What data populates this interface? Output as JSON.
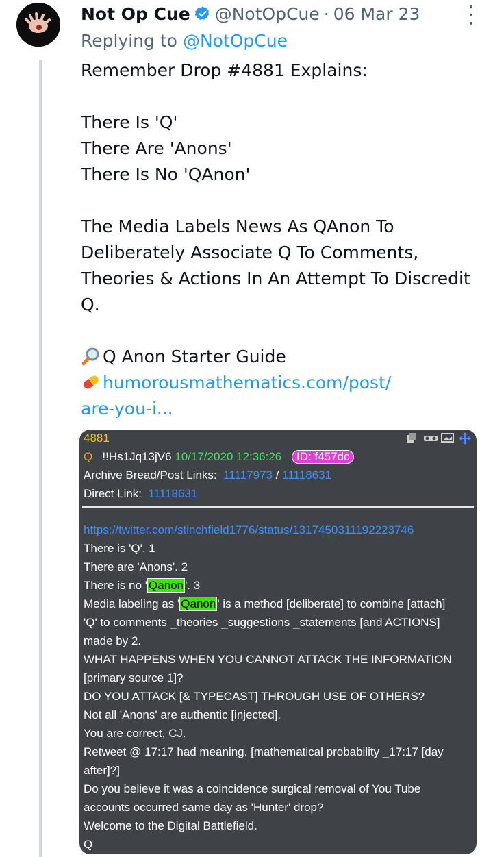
{
  "tweet": {
    "display_name": "Not Op Cue",
    "handle": "@NotOpCue",
    "separator": "·",
    "date": "06 Mar 23",
    "replying_to_label": "Replying to",
    "replying_to_handle": "@NotOpCue",
    "lines": [
      "Remember Drop #4881 Explains:",
      "",
      "There Is 'Q'",
      "There Are 'Anons'",
      "There Is No 'QAnon'",
      "",
      "The Media Labels News As QAnon To",
      "Deliberately Associate Q To Comments,",
      "Theories & Actions In An Attempt To Discredit",
      "Q.",
      ""
    ],
    "guide_label": "Q Anon Starter Guide",
    "link_line1": "humorousmathematics.com/post/",
    "link_line2": "are-you-i..."
  },
  "icons": {
    "verified": "verified-badge-icon",
    "more": "more-options-icon",
    "magnifier": "magnifying-glass-emoji",
    "pill": "pill-emoji"
  },
  "colors": {
    "link": "#1d9bf0",
    "muted": "#536471",
    "card_bg": "#3f4347",
    "highlight": "#39e600"
  },
  "drop": {
    "number": "4881",
    "q": "Q",
    "tripcode": "!!Hs1Jq13jV6",
    "timestamp": "10/17/2020 12:36:26",
    "id_badge": "ID: f457dc",
    "archive_label": "Archive Bread/Post Links:",
    "archive_link1": "11117973",
    "archive_sep": "/",
    "archive_link2": "11118631",
    "direct_label": "Direct Link:",
    "direct_link": "11118631",
    "url": "https://twitter.com/stinchfield1776/status/1317450311192223746",
    "l1": "There is 'Q'. 1",
    "l2": "There are 'Anons'. 2",
    "l3_pre": "There is no '",
    "l3_hl": "Qanon",
    "l3_post": "'. 3",
    "l4_pre": "Media labeling as '",
    "l4_hl": "Qanon",
    "l4_post": "' is a method [deliberate] to combine [attach]",
    "l5": "'Q' to comments _theories _suggestions _statements [and ACTIONS]",
    "l6": "made by 2.",
    "l7": "WHAT HAPPENS WHEN YOU CANNOT ATTACK THE INFORMATION",
    "l8": "[primary source 1]?",
    "l9": "DO YOU ATTACK [& TYPECAST] THROUGH USE OF OTHERS?",
    "l10": "Not all 'Anons' are authentic [injected].",
    "l11": "You are correct, CJ.",
    "l12": "Retweet @ 17:17 had meaning. [mathematical probability _17:17 [day",
    "l13": "after]?]",
    "l14": "Do you believe it was a coincidence surgical removal of You Tube",
    "l15": "accounts occurred same day as 'Hunter' drop?",
    "l16": "Welcome to the Digital Battlefield.",
    "l17": "Q"
  }
}
